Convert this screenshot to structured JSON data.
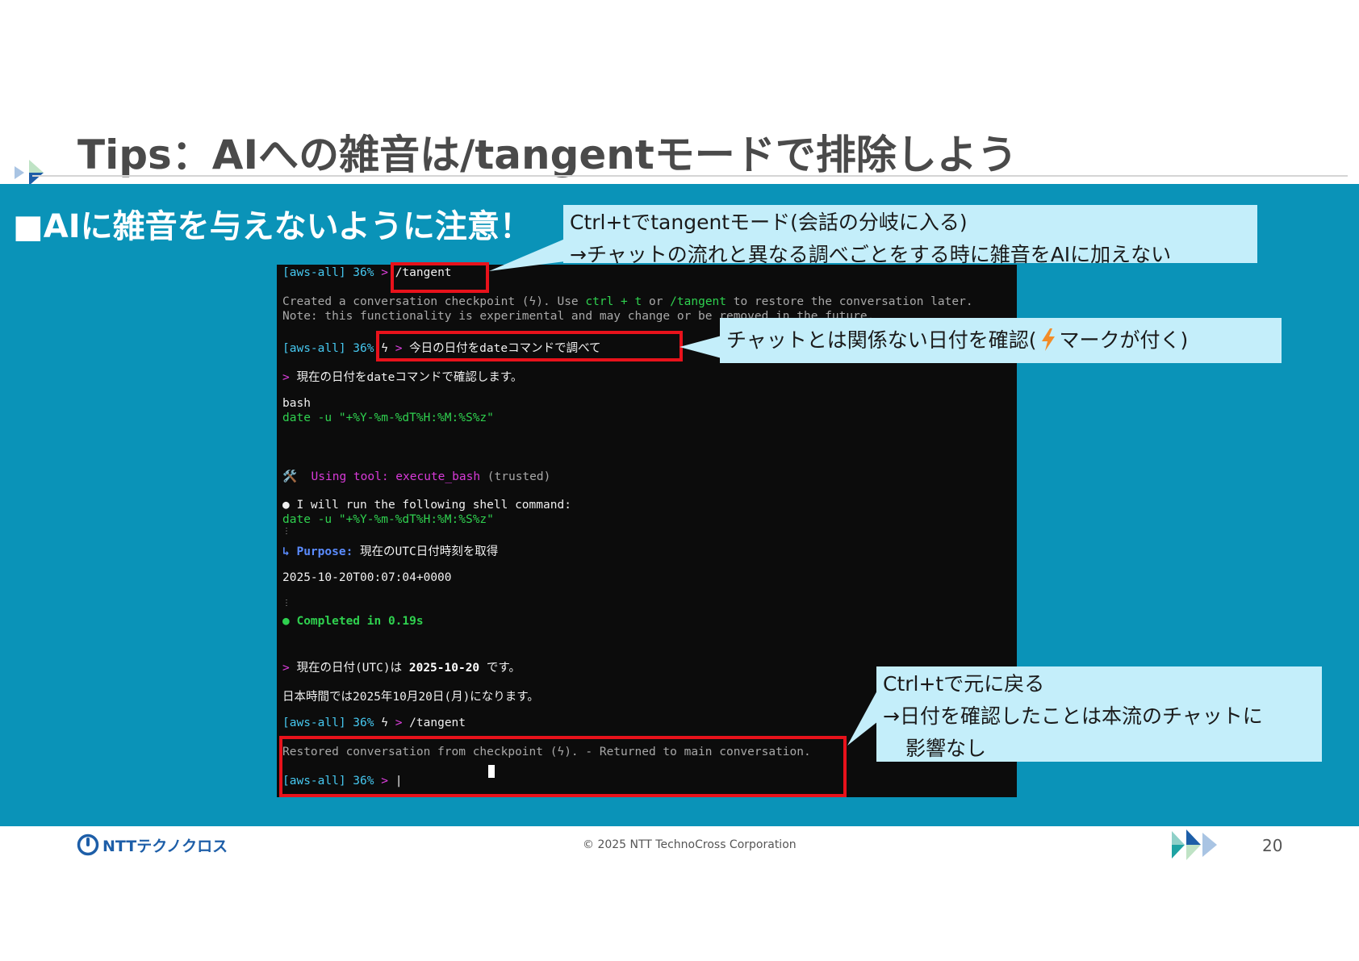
{
  "slide": {
    "title": "Tips：AIへの雑音は/tangentモードで排除しよう",
    "heading": "■AIに雑音を与えないように注意！",
    "page_number": "20"
  },
  "terminal": {
    "line1": {
      "prompt": "[aws-all] 36%",
      "arrow": ">",
      "command": "/tangent"
    },
    "line2a": "Created a conversation checkpoint (ϟ). Use",
    "line2b": "ctrl + t",
    "line2c": "or",
    "line2d": "/tangent",
    "line2e": "to restore the conversation later.",
    "line3": "Note: this functionality is experimental and may change or be removed in the future.",
    "line4": {
      "prompt": "[aws-all] 36%",
      "bolt": "ϟ",
      "arrow": ">",
      "command": "今日の日付をdateコマンドで調べて"
    },
    "line5": {
      "arrow": ">",
      "text": "現在の日付をdateコマンドで確認します。"
    },
    "line6": "bash",
    "line7": "date -u \"+%Y-%m-%dT%H:%M:%S%z\"",
    "line8": {
      "icon": "🛠️",
      "tool": "Using tool: execute_bash",
      "trusted": "(trusted)"
    },
    "line9": "● I will run the following shell command:",
    "line10": "date -u \"+%Y-%m-%dT%H:%M:%S%z\"",
    "line11": {
      "label": "↳ Purpose:",
      "text": "現在のUTC日付時刻を取得"
    },
    "line12": "2025-10-20T00:07:04+0000",
    "line13": "● Completed in 0.19s",
    "line14": {
      "arrow": ">",
      "pre": "現在の日付(UTC)は",
      "date": "2025-10-20",
      "post": "です。"
    },
    "line15": "日本時間では2025年10月20日(月)になります。",
    "line16": {
      "prompt": "[aws-all] 36%",
      "bolt": "ϟ",
      "arrow": ">",
      "command": "/tangent"
    },
    "line17": "Restored conversation from checkpoint (ϟ). - Returned to main conversation.",
    "line18": {
      "prompt": "[aws-all] 36%",
      "arrow": ">"
    }
  },
  "callouts": {
    "top": {
      "line1": "Ctrl+tでtangentモード(会話の分岐に入る)",
      "line2": "→チャットの流れと異なる調べごとをする時に雑音をAIに加えない"
    },
    "middle": {
      "pre": "チャットとは関係ない日付を確認(",
      "icon": "lightning-icon",
      "post": "マークが付く)"
    },
    "bottom": {
      "line1": "Ctrl+tで元に戻る",
      "line2": "→日付を確認したことは本流のチャットに",
      "line3": "影響なし"
    }
  },
  "footer": {
    "brand": "NTTテクノクロス",
    "copyright": "© 2025 NTT TechnoCross Corporation"
  },
  "colors": {
    "band": "#0a93b8",
    "callout": "#c4eefa",
    "highlight_box": "#e8121b",
    "title": "#4a4a4a"
  }
}
